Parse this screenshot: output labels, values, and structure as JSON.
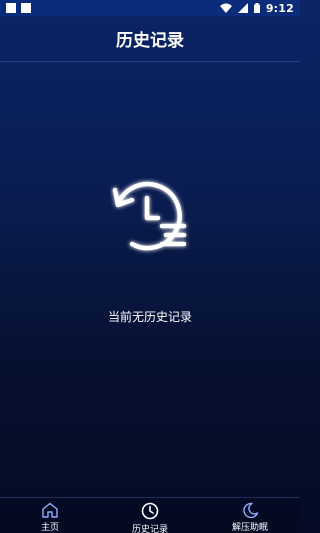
{
  "status_bar": {
    "time": "9:12",
    "icons": [
      "notification-square-icon",
      "notification-square-icon",
      "wifi-icon",
      "signal-icon",
      "battery-icon"
    ]
  },
  "header": {
    "title": "历史记录"
  },
  "empty_state": {
    "icon": "history-clock-icon",
    "message": "当前无历史记录"
  },
  "bottom_nav": {
    "items": [
      {
        "label": "主页",
        "icon": "home-icon",
        "active": false
      },
      {
        "label": "历史记录",
        "icon": "clock-icon",
        "active": true
      },
      {
        "label": "解压助眠",
        "icon": "moon-icon",
        "active": false
      }
    ]
  },
  "colors": {
    "background_top": "#0a2466",
    "background_bottom": "#050b24",
    "accent": "#7ea0ff",
    "text": "#ffffff"
  }
}
